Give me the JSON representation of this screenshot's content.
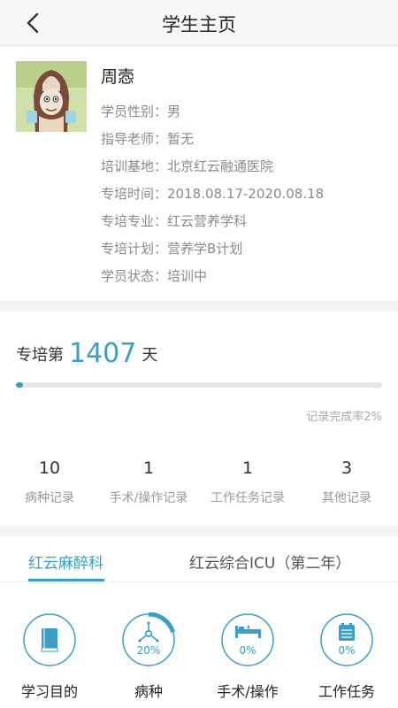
{
  "header": {
    "title": "学生主页",
    "back_icon": "chevron-left-icon"
  },
  "profile": {
    "name": "周悫",
    "rows": [
      {
        "label": "学员性别：",
        "value": "男"
      },
      {
        "label": "指导老师：",
        "value": "暂无"
      },
      {
        "label": "培训基地：",
        "value": "北京红云融通医院"
      },
      {
        "label": "专培时间：",
        "value": "2018.08.17-2020.08.18"
      },
      {
        "label": "专培专业：",
        "value": "红云营养学科"
      },
      {
        "label": "专培计划：",
        "value": "营养学B计划"
      },
      {
        "label": "学员状态：",
        "value": "培训中"
      }
    ]
  },
  "stats": {
    "days_prefix": "专培第",
    "days_value": "1407",
    "days_suffix": "天",
    "progress_fraction": 0.02,
    "completion_text": "记录完成率2%",
    "items": [
      {
        "count": "10",
        "label": "病种记录"
      },
      {
        "count": "1",
        "label": "手术/操作记录"
      },
      {
        "count": "1",
        "label": "工作任务记录"
      },
      {
        "count": "3",
        "label": "其他记录"
      }
    ]
  },
  "tabs": [
    {
      "label": "红云麻醉科",
      "active": true
    },
    {
      "label": "红云综合ICU（第二年）",
      "active": false
    }
  ],
  "categories": [
    {
      "label": "学习目的",
      "icon": "book-icon",
      "pct": ""
    },
    {
      "label": "病种",
      "icon": "molecule-icon",
      "pct": "20%",
      "fraction": 0.2
    },
    {
      "label": "手术/操作",
      "icon": "bed-icon",
      "pct": "0%",
      "fraction": 0
    },
    {
      "label": "工作任务",
      "icon": "clipboard-icon",
      "pct": "0%",
      "fraction": 0
    }
  ],
  "colors": {
    "accent": "#3a9fc0"
  }
}
